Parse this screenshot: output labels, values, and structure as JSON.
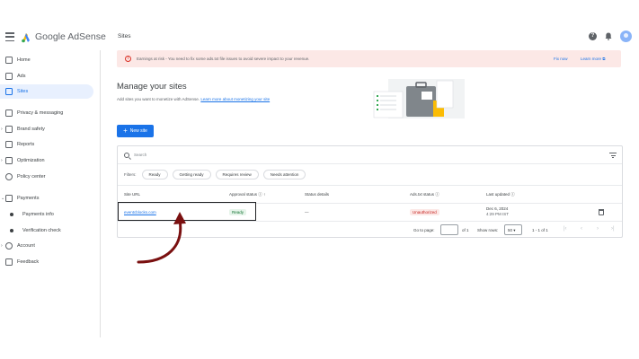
{
  "header": {
    "brand_google": "Google",
    "brand_product": "AdSense",
    "page_title": "Sites"
  },
  "sidebar": {
    "items": [
      {
        "label": "Home",
        "icon": "home-icon"
      },
      {
        "label": "Ads",
        "icon": "ads-icon"
      },
      {
        "label": "Sites",
        "icon": "sites-icon",
        "active": true
      },
      {
        "label": "Privacy & messaging",
        "icon": "privacy-icon"
      },
      {
        "label": "Brand safety",
        "icon": "shield-icon"
      },
      {
        "label": "Reports",
        "icon": "reports-icon"
      },
      {
        "label": "Optimization",
        "icon": "trend-icon"
      },
      {
        "label": "Policy center",
        "icon": "policy-icon"
      },
      {
        "label": "Payments",
        "icon": "payments-icon"
      },
      {
        "label": "Payments info",
        "icon": "dot"
      },
      {
        "label": "Verification check",
        "icon": "dot"
      },
      {
        "label": "Account",
        "icon": "gear-icon"
      },
      {
        "label": "Feedback",
        "icon": "feedback-icon"
      }
    ]
  },
  "banner": {
    "text": "Earnings at risk - You need to fix some ads.txt file issues to avoid severe impact to your revenue.",
    "fix_now": "Fix now",
    "learn_more": "Learn more"
  },
  "main": {
    "heading": "Manage your sites",
    "subtitle_text": "Add sites you want to monetize with AdSense.",
    "subtitle_link": "Learn more about monetizing your site",
    "new_site_label": "New site",
    "search_placeholder": "Search"
  },
  "filters": {
    "label": "Filters:",
    "chips": [
      "Ready",
      "Getting ready",
      "Requires review",
      "Needs attention"
    ]
  },
  "table": {
    "columns": [
      "Site URL",
      "Approval status",
      "Status details",
      "Ads.txt status",
      "Last updated"
    ],
    "rows": [
      {
        "site_url": "eventcblocks.com",
        "approval_status": "Ready",
        "status_details": "—",
        "ads_txt_status": "Unauthorized",
        "last_updated_date": "Dec 6, 2024",
        "last_updated_time": "4:29 PM IST"
      }
    ]
  },
  "pager": {
    "go_to_page": "Go to page:",
    "of_pages": "of 1",
    "show_rows": "Show rows:",
    "rows_value": "50",
    "range": "1 - 1 of 1"
  },
  "colors": {
    "accent": "#1a73e8",
    "banner_bg": "#fce8e6",
    "ready": "#137333",
    "unauthorized": "#c5221f"
  }
}
